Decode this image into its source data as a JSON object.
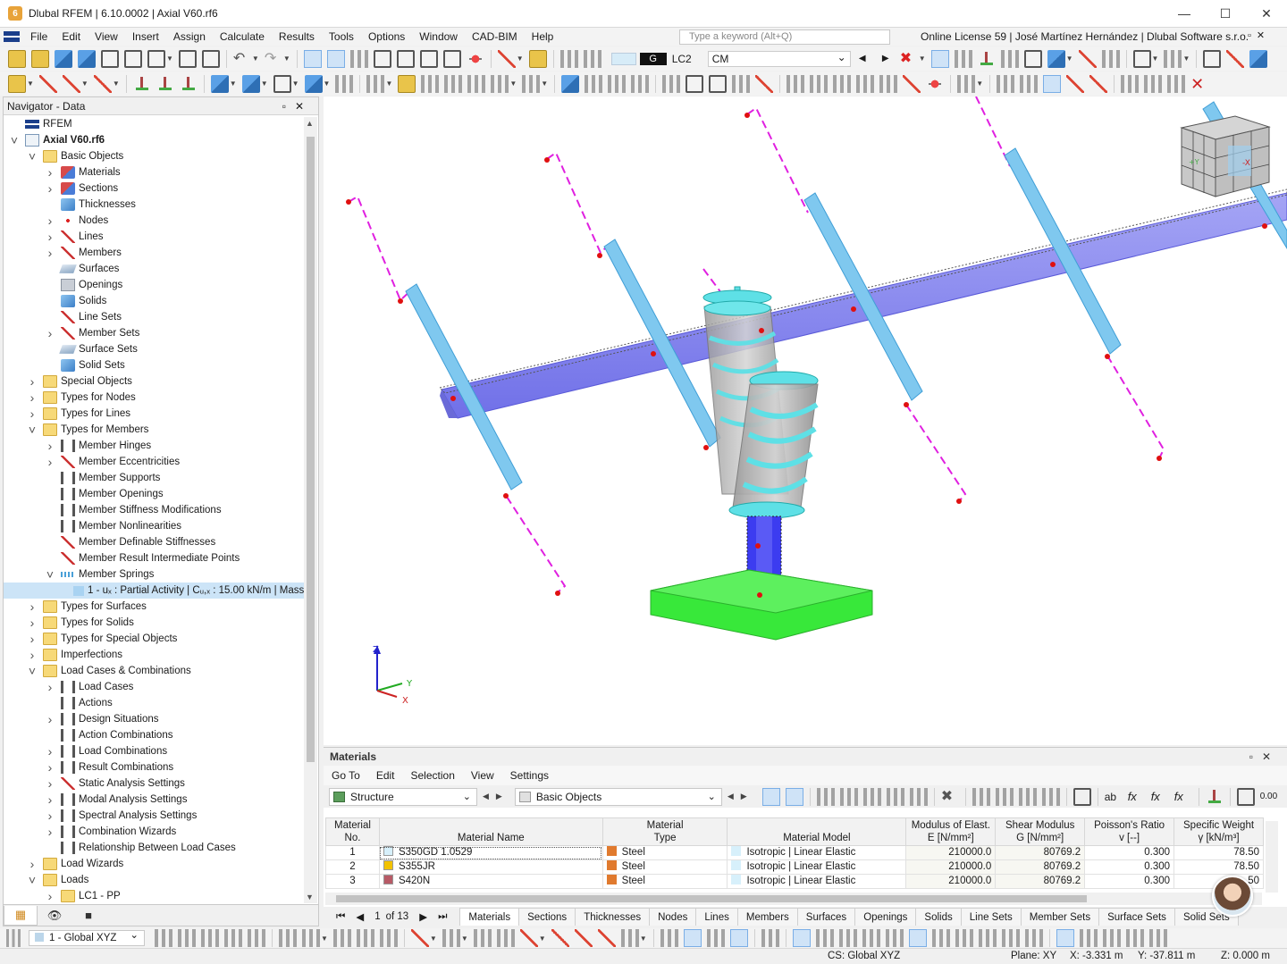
{
  "window": {
    "title": "Dlubal RFEM | 6.10.0002 | Axial V60.rf6",
    "controls": [
      "minimize",
      "maximize",
      "close"
    ]
  },
  "menu": [
    "File",
    "Edit",
    "View",
    "Insert",
    "Assign",
    "Calculate",
    "Results",
    "Tools",
    "Options",
    "Window",
    "CAD-BIM",
    "Help"
  ],
  "search": {
    "placeholder": "Type a keyword (Alt+Q)"
  },
  "license": "Online License 59 | José Martínez Hernández | Dlubal Software s.r.o.",
  "loadcase": {
    "g_label": "G",
    "name": "LC2",
    "description": "CM"
  },
  "navigator": {
    "title": "Navigator - Data",
    "items": [
      {
        "label": "RFEM",
        "level": 0,
        "arrow": "",
        "icon": "root"
      },
      {
        "label": "Axial V60.rf6",
        "level": 0,
        "arrow": "v",
        "icon": "file",
        "bold": true
      },
      {
        "label": "Basic Objects",
        "level": 1,
        "arrow": "v",
        "icon": "folder"
      },
      {
        "label": "Materials",
        "level": 2,
        "arrow": ">",
        "icon": "red"
      },
      {
        "label": "Sections",
        "level": 2,
        "arrow": ">",
        "icon": "red"
      },
      {
        "label": "Thicknesses",
        "level": 2,
        "arrow": "",
        "icon": "blue"
      },
      {
        "label": "Nodes",
        "level": 2,
        "arrow": ">",
        "icon": "dot"
      },
      {
        "label": "Lines",
        "level": 2,
        "arrow": ">",
        "icon": "line"
      },
      {
        "label": "Members",
        "level": 2,
        "arrow": ">",
        "icon": "line"
      },
      {
        "label": "Surfaces",
        "level": 2,
        "arrow": "",
        "icon": "plate"
      },
      {
        "label": "Openings",
        "level": 2,
        "arrow": "",
        "icon": "gray"
      },
      {
        "label": "Solids",
        "level": 2,
        "arrow": "",
        "icon": "blue"
      },
      {
        "label": "Line Sets",
        "level": 2,
        "arrow": "",
        "icon": "line"
      },
      {
        "label": "Member Sets",
        "level": 2,
        "arrow": ">",
        "icon": "line"
      },
      {
        "label": "Surface Sets",
        "level": 2,
        "arrow": "",
        "icon": "plate"
      },
      {
        "label": "Solid Sets",
        "level": 2,
        "arrow": "",
        "icon": "blue"
      },
      {
        "label": "Special Objects",
        "level": 1,
        "arrow": ">",
        "icon": "folder"
      },
      {
        "label": "Types for Nodes",
        "level": 1,
        "arrow": ">",
        "icon": "folder"
      },
      {
        "label": "Types for Lines",
        "level": 1,
        "arrow": ">",
        "icon": "folder"
      },
      {
        "label": "Types for Members",
        "level": 1,
        "arrow": "v",
        "icon": "folder"
      },
      {
        "label": "Member Hinges",
        "level": 2,
        "arrow": ">",
        "icon": "dark"
      },
      {
        "label": "Member Eccentricities",
        "level": 2,
        "arrow": ">",
        "icon": "line"
      },
      {
        "label": "Member Supports",
        "level": 2,
        "arrow": "",
        "icon": "dark"
      },
      {
        "label": "Member Openings",
        "level": 2,
        "arrow": "",
        "icon": "dark"
      },
      {
        "label": "Member Stiffness Modifications",
        "level": 2,
        "arrow": "",
        "icon": "dark"
      },
      {
        "label": "Member Nonlinearities",
        "level": 2,
        "arrow": "",
        "icon": "dark"
      },
      {
        "label": "Member Definable Stiffnesses",
        "level": 2,
        "arrow": "",
        "icon": "line"
      },
      {
        "label": "Member Result Intermediate Points",
        "level": 2,
        "arrow": "",
        "icon": "line"
      },
      {
        "label": "Member Springs",
        "level": 2,
        "arrow": "v",
        "icon": "spring"
      },
      {
        "label": "1 - uₓ : Partial Activity | Cᵤ,ₓ : 15.00 kN/m | Mass",
        "level": 3,
        "arrow": "",
        "icon": "sel",
        "selected": true
      },
      {
        "label": "Types for Surfaces",
        "level": 1,
        "arrow": ">",
        "icon": "folder"
      },
      {
        "label": "Types for Solids",
        "level": 1,
        "arrow": ">",
        "icon": "folder"
      },
      {
        "label": "Types for Special Objects",
        "level": 1,
        "arrow": ">",
        "icon": "folder"
      },
      {
        "label": "Imperfections",
        "level": 1,
        "arrow": ">",
        "icon": "folder"
      },
      {
        "label": "Load Cases & Combinations",
        "level": 1,
        "arrow": "v",
        "icon": "folder"
      },
      {
        "label": "Load Cases",
        "level": 2,
        "arrow": ">",
        "icon": "dark"
      },
      {
        "label": "Actions",
        "level": 2,
        "arrow": "",
        "icon": "dark"
      },
      {
        "label": "Design Situations",
        "level": 2,
        "arrow": ">",
        "icon": "dark"
      },
      {
        "label": "Action Combinations",
        "level": 2,
        "arrow": "",
        "icon": "dark"
      },
      {
        "label": "Load Combinations",
        "level": 2,
        "arrow": ">",
        "icon": "dark"
      },
      {
        "label": "Result Combinations",
        "level": 2,
        "arrow": ">",
        "icon": "dark"
      },
      {
        "label": "Static Analysis Settings",
        "level": 2,
        "arrow": ">",
        "icon": "line"
      },
      {
        "label": "Modal Analysis Settings",
        "level": 2,
        "arrow": ">",
        "icon": "dark"
      },
      {
        "label": "Spectral Analysis Settings",
        "level": 2,
        "arrow": ">",
        "icon": "dark"
      },
      {
        "label": "Combination Wizards",
        "level": 2,
        "arrow": ">",
        "icon": "dark"
      },
      {
        "label": "Relationship Between Load Cases",
        "level": 2,
        "arrow": "",
        "icon": "dark"
      },
      {
        "label": "Load Wizards",
        "level": 1,
        "arrow": ">",
        "icon": "folder"
      },
      {
        "label": "Loads",
        "level": 1,
        "arrow": "v",
        "icon": "folder"
      },
      {
        "label": "LC1 - PP",
        "level": 2,
        "arrow": ">",
        "icon": "folder"
      }
    ]
  },
  "axes": {
    "x": "X",
    "y": "Y",
    "z": "Z"
  },
  "materials_panel": {
    "title": "Materials",
    "menu": [
      "Go To",
      "Edit",
      "Selection",
      "View",
      "Settings"
    ],
    "structure_combo": "Structure",
    "objects_combo": "Basic Objects",
    "columns": [
      {
        "line1": "Material",
        "line2": "No."
      },
      {
        "line1": "",
        "line2": "Material Name"
      },
      {
        "line1": "Material",
        "line2": "Type"
      },
      {
        "line1": "",
        "line2": "Material Model"
      },
      {
        "line1": "Modulus of Elast.",
        "line2": "E [N/mm²]"
      },
      {
        "line1": "Shear Modulus",
        "line2": "G [N/mm²]"
      },
      {
        "line1": "Poisson's Ratio",
        "line2": "v [--]"
      },
      {
        "line1": "Specific Weight",
        "line2": "γ [kN/m³]"
      }
    ],
    "rows": [
      {
        "no": "1",
        "name": "S350GD 1.0529",
        "name_color": "#d7f0fb",
        "type": "Steel",
        "type_color": "#e07a2e",
        "model": "Isotropic | Linear Elastic",
        "E": "210000.0",
        "G": "80769.2",
        "nu": "0.300",
        "gamma": "78.50"
      },
      {
        "no": "2",
        "name": "S355JR",
        "name_color": "#f2c200",
        "type": "Steel",
        "type_color": "#e07a2e",
        "model": "Isotropic | Linear Elastic",
        "E": "210000.0",
        "G": "80769.2",
        "nu": "0.300",
        "gamma": "78.50"
      },
      {
        "no": "3",
        "name": "S420N",
        "name_color": "#b75a66",
        "type": "Steel",
        "type_color": "#e07a2e",
        "model": "Isotropic | Linear Elastic",
        "E": "210000.0",
        "G": "80769.2",
        "nu": "0.300",
        "gamma": "50"
      }
    ],
    "pager": {
      "current": "1",
      "of_label": "of 13"
    },
    "tabs": [
      "Materials",
      "Sections",
      "Thicknesses",
      "Nodes",
      "Lines",
      "Members",
      "Surfaces",
      "Openings",
      "Solids",
      "Line Sets",
      "Member Sets",
      "Surface Sets",
      "Solid Sets"
    ],
    "active_tab": "Materials"
  },
  "coordinate_system": "1 - Global XYZ",
  "status": {
    "cs": "CS: Global XYZ",
    "plane": "Plane: XY",
    "x": "X: -3.331 m",
    "y": "Y: -37.811 m",
    "z": "Z: 0.000 m"
  },
  "colors": {
    "member_cyan": "#7fc8ef",
    "beam_blue": "#8585ef",
    "column_blue": "#3c3cf0",
    "foundation_green": "#38e83a",
    "dashed_magenta": "#e020e0",
    "spring_cyan": "#5ee0e6"
  }
}
